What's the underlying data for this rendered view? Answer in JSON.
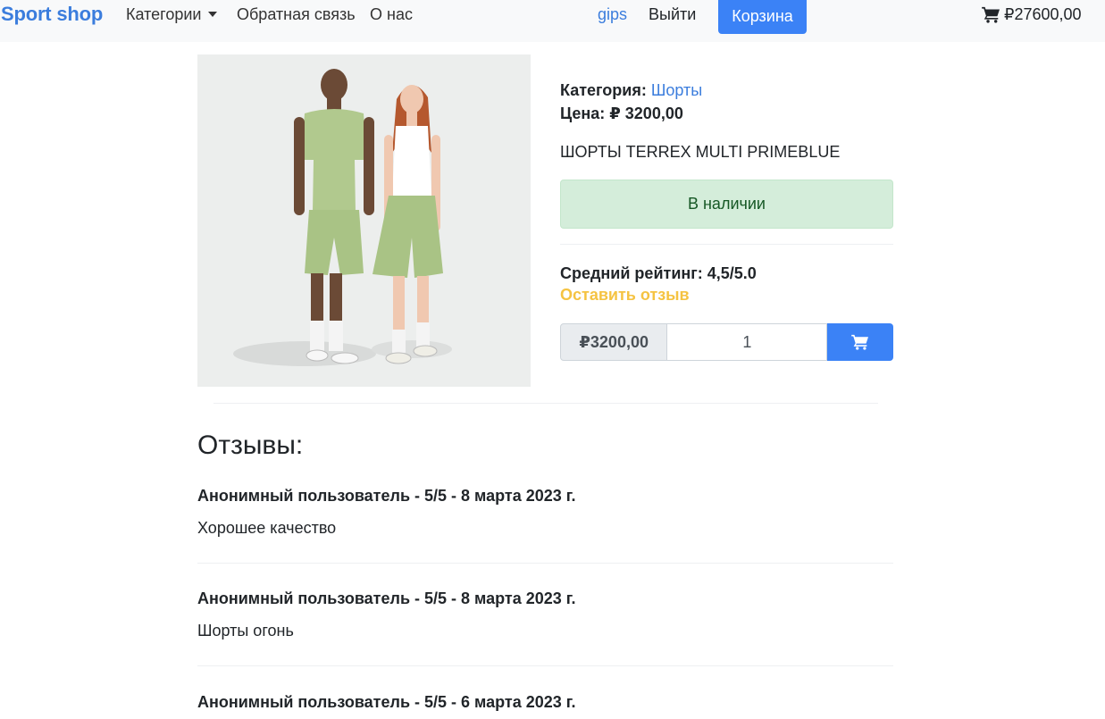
{
  "navbar": {
    "brand": "Sport shop",
    "categories": "Категории",
    "feedback": "Обратная связь",
    "about": "О нас",
    "username": "gips",
    "logout": "Выйти",
    "cart": "Корзина",
    "cart_total": "₽27600,00"
  },
  "product": {
    "category_label": "Категория:",
    "category_value": "Шорты",
    "price_label": "Цена: ₽ 3200,00",
    "name": "ШОРТЫ TERREX MULTI PRIMEBLUE",
    "stock": "В наличии",
    "rating": "Средний рейтинг: 4,5/5.0",
    "leave_review": "Оставить отзыв",
    "price_addon": "₽3200,00",
    "quantity": "1"
  },
  "reviews": {
    "title": "Отзывы:",
    "items": [
      {
        "header": "Анонимный пользователь - 5/5 - 8 марта 2023 г.",
        "text": "Хорошее качество"
      },
      {
        "header": "Анонимный пользователь - 5/5 - 8 марта 2023 г.",
        "text": "Шорты огонь"
      },
      {
        "header": "Анонимный пользователь - 5/5 - 6 марта 2023 г.",
        "text": ""
      }
    ]
  },
  "colors": {
    "brand": "#3b7ddd",
    "primary_button": "#3b82f6",
    "stock_bg": "#d4edda",
    "stock_text": "#155724",
    "review_link": "#f5c342"
  },
  "icons": {
    "cart": "shopping-cart-icon",
    "dropdown": "caret-down-icon"
  }
}
